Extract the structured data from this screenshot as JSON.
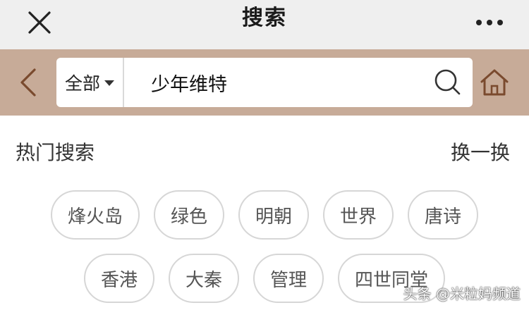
{
  "header": {
    "title": "搜索",
    "close_icon": "close-icon",
    "more_icon": "more-dots-icon"
  },
  "search": {
    "scope_label": "全部",
    "query": "少年维特",
    "search_icon": "search-icon",
    "back_icon": "chevron-left-icon",
    "home_icon": "home-icon"
  },
  "hot": {
    "title": "热门搜索",
    "refresh_label": "换一换",
    "rows": [
      [
        "烽火岛",
        "绿色",
        "明朝",
        "世界",
        "唐诗"
      ],
      [
        "香港",
        "大秦",
        "管理",
        "四世同堂"
      ]
    ]
  },
  "watermark": "头条 @米粒妈频道",
  "colors": {
    "topbar_bg": "#efefef",
    "searchrow_bg": "#c7ab98",
    "icon_brown": "#7a4a2e",
    "tag_border": "#d6d6d6"
  }
}
